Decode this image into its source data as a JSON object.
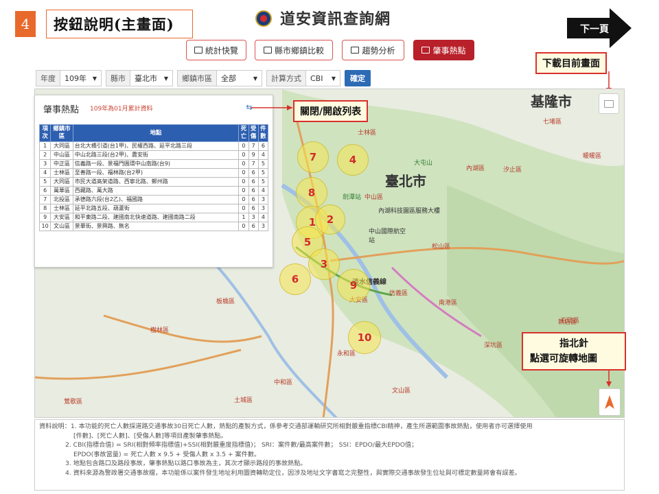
{
  "slide": {
    "number": "4",
    "title": "按鈕說明(主畫面)",
    "next_label": "下一頁"
  },
  "app": {
    "title": "道安資訊查詢網"
  },
  "tabs": [
    {
      "label": "統計快覽",
      "icon": "chart-card-icon"
    },
    {
      "label": "縣市鄉鎮比較",
      "icon": "bar-chart-icon"
    },
    {
      "label": "趨勢分析",
      "icon": "line-chart-icon"
    },
    {
      "label": "肇事熱點",
      "icon": "map-icon",
      "active": true
    }
  ],
  "callouts": {
    "download": "下載目前畫面",
    "toggle_list": "關閉/開啟列表",
    "compass_line1": "指北針",
    "compass_line2": "點選可旋轉地圖"
  },
  "filters": {
    "year_label": "年度",
    "year_value": "109年",
    "city_label": "縣市",
    "city_value": "臺北市",
    "district_label": "鄉鎮市區",
    "district_value": "全部",
    "method_label": "計算方式",
    "method_value": "CBI",
    "submit_label": "確定"
  },
  "panel": {
    "title": "肇事熱點",
    "subtitle": "109年為01月累計資料",
    "columns": [
      "項次",
      "鄉鎮市區",
      "地點",
      "死亡",
      "受傷",
      "件數"
    ],
    "rows": [
      [
        "1",
        "大同區",
        "台北大橋引道(台1甲)、民權西路、延平北路三段",
        "0",
        "7",
        "6"
      ],
      [
        "2",
        "中山區",
        "中山北路三段(台2甲)、農安街",
        "0",
        "9",
        "4"
      ],
      [
        "3",
        "中正區",
        "信義路一段、景福門圓環中山南路(台9)",
        "0",
        "7",
        "5"
      ],
      [
        "4",
        "士林區",
        "至善路一段、福林路(台2甲)",
        "0",
        "6",
        "5"
      ],
      [
        "5",
        "大同區",
        "市民大道高架道路、西寧北路、鄭州路",
        "0",
        "6",
        "5"
      ],
      [
        "6",
        "萬華區",
        "西藏路、萬大路",
        "0",
        "6",
        "4"
      ],
      [
        "7",
        "北投區",
        "承德路六段(台2乙)、福國路",
        "0",
        "6",
        "3"
      ],
      [
        "8",
        "士林區",
        "延平北路五段、葫蘆街",
        "0",
        "6",
        "3"
      ],
      [
        "9",
        "大安區",
        "和平東路二段、建國南北快速道路、建國南路二段",
        "1",
        "3",
        "4"
      ],
      [
        "10",
        "文山區",
        "景華街、景興路、無名",
        "0",
        "6",
        "3"
      ]
    ]
  },
  "clusters": [
    "7",
    "4",
    "8",
    "1",
    "2",
    "5",
    "3",
    "6",
    "9",
    "10"
  ],
  "map_labels": {
    "keelung": "基隆市",
    "taipei": "臺北市",
    "shilin": "士林區",
    "zhongshan": "中山區",
    "neihu": "內湖區",
    "xizhi": "汐止區",
    "songshan": "松山區",
    "xinyi": "信義區",
    "nangang": "南港區",
    "datong": "大同區",
    "banqiao": "板橋區",
    "tucheng": "土城區",
    "zhonghe": "中和區",
    "yonghe": "永和區",
    "wenshan": "文山區",
    "shenkeng": "深坑區",
    "shiding": "石碇區",
    "yingge": "鶯歌區",
    "shulin": "樹林區",
    "qidu": "七堵區",
    "xindian": "新店區",
    "daan": "大安區",
    "nuannuan": "暖暖區",
    "hsinchu_line": "淡水信義線",
    "yuanshan": "劍潭站",
    "guangming": "內湖科技園區服務大樓",
    "zhongshan_stn": "中山國際航空站",
    "dahuashan": "大屯山"
  },
  "notes": [
    "資料說明：1. 本功能的死亡人數採道路交通事故30日死亡人數，熱點的產製方式，係參考交通部運輸研究所相對嚴重指標CBI精神，產生所選範圍事故熱點，使用者亦可選擇使用",
    "[件數]、[死亡人數]、[受傷人數]等項目產製肇事熱點。",
    "2. CBI(指標合值) = SRI(相對頻率指標值)+SSI(相對嚴重度指標值)； SRI：案件數/最高案件數； SSI：EPDO/最大EPDO值；",
    "EPDO(事故當量) = 死亡人數 x 9.5 + 受傷人數 x 3.5 + 案件數。",
    "3. 地點包含路口及路段事故，肇事熱點以路口事故為主，其次才顯示路段的事故熱點。",
    "4. 資料來源為警政署交通事故檔，本功能係以案件發生地址利用圖資轉助定位，因涉及地址文字書寫之完整性，與實際交通事故發生位址與可標定數量將會有誤差。"
  ]
}
